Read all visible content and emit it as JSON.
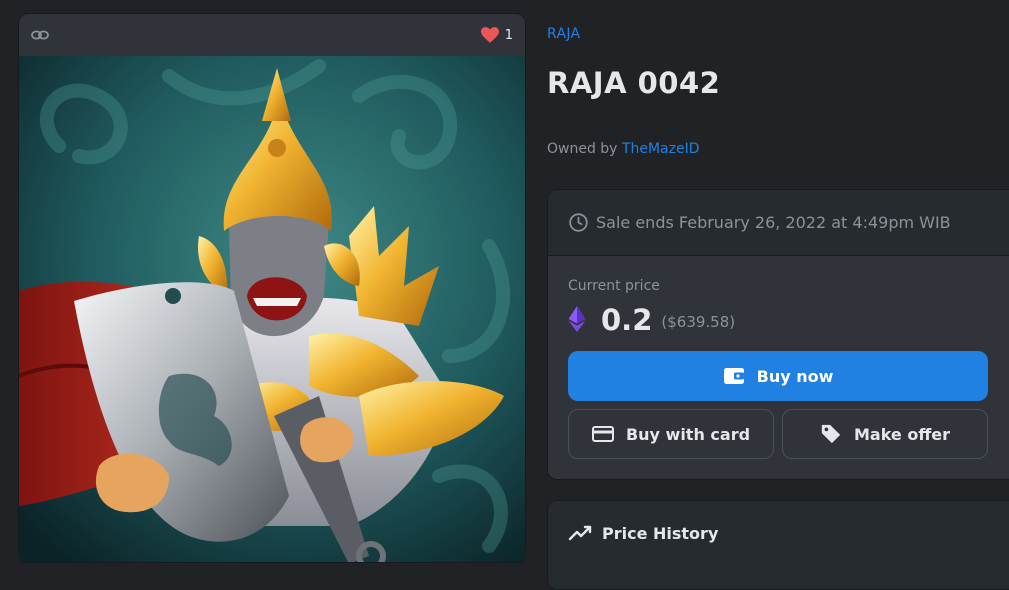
{
  "item": {
    "favorites_count": "1",
    "collection": "RAJA",
    "title": "RAJA 0042",
    "owner_prefix": "Owned by",
    "owner_name": "TheMazeID"
  },
  "sale": {
    "ends_text": "Sale ends February 26, 2022 at 4:49pm WIB",
    "current_price_label": "Current price",
    "price_eth": "0.2",
    "price_usd": "($639.58)",
    "currency_icon": "ethereum-icon"
  },
  "actions": {
    "buy_now": "Buy now",
    "buy_with_card": "Buy with card",
    "make_offer": "Make offer"
  },
  "price_history": {
    "label": "Price History"
  },
  "icons": {
    "chain": "link-icon",
    "favorite": "heart-icon",
    "clock": "clock-icon",
    "wallet": "wallet-icon",
    "card": "credit-card-icon",
    "offer": "tag-icon",
    "history": "trend-line-icon"
  },
  "colors": {
    "background": "#202225",
    "panel": "#303339",
    "panel_header": "#262b2f",
    "accent": "#2081e2",
    "text_primary": "#e5e8eb",
    "text_secondary": "#8a939b",
    "heart": "#eb5757"
  }
}
